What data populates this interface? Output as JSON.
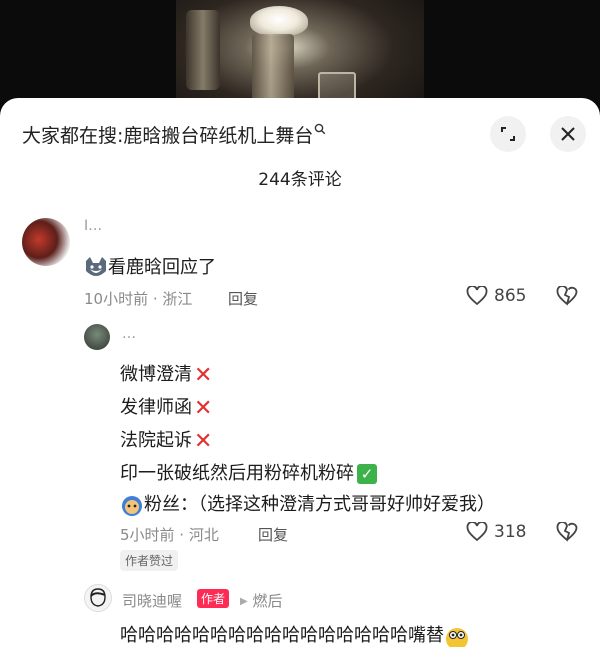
{
  "search": {
    "prefix": "大家都在搜:",
    "query": "鹿晗搬台碎纸机上舞台",
    "icon": "search-icon"
  },
  "header": {
    "comment_count": "244条评论"
  },
  "comments": [
    {
      "user": "I…",
      "text": "看鹿晗回应了",
      "time": "10小时前 · 浙江",
      "reply_label": "回复",
      "likes": "865"
    },
    {
      "user": "…",
      "lines": [
        "微博澄清",
        "发律师函",
        "法院起诉",
        "印一张破纸然后用粉碎机粉碎"
      ],
      "last_line": "粉丝：（选择这种澄清方式哥哥好帅好爱我）",
      "time": "5小时前 · 河北",
      "reply_label": "回复",
      "likes": "318",
      "badge": "作者赞过"
    },
    {
      "user": "司晓迪喔",
      "author_tag": "作者",
      "reply_to": "燃后",
      "text": "哈哈哈哈哈哈哈哈哈哈哈哈哈哈哈哈嘴替"
    }
  ],
  "colors": {
    "accent": "#fe2c55",
    "cross": "#e23030",
    "check": "#3eb24a"
  }
}
